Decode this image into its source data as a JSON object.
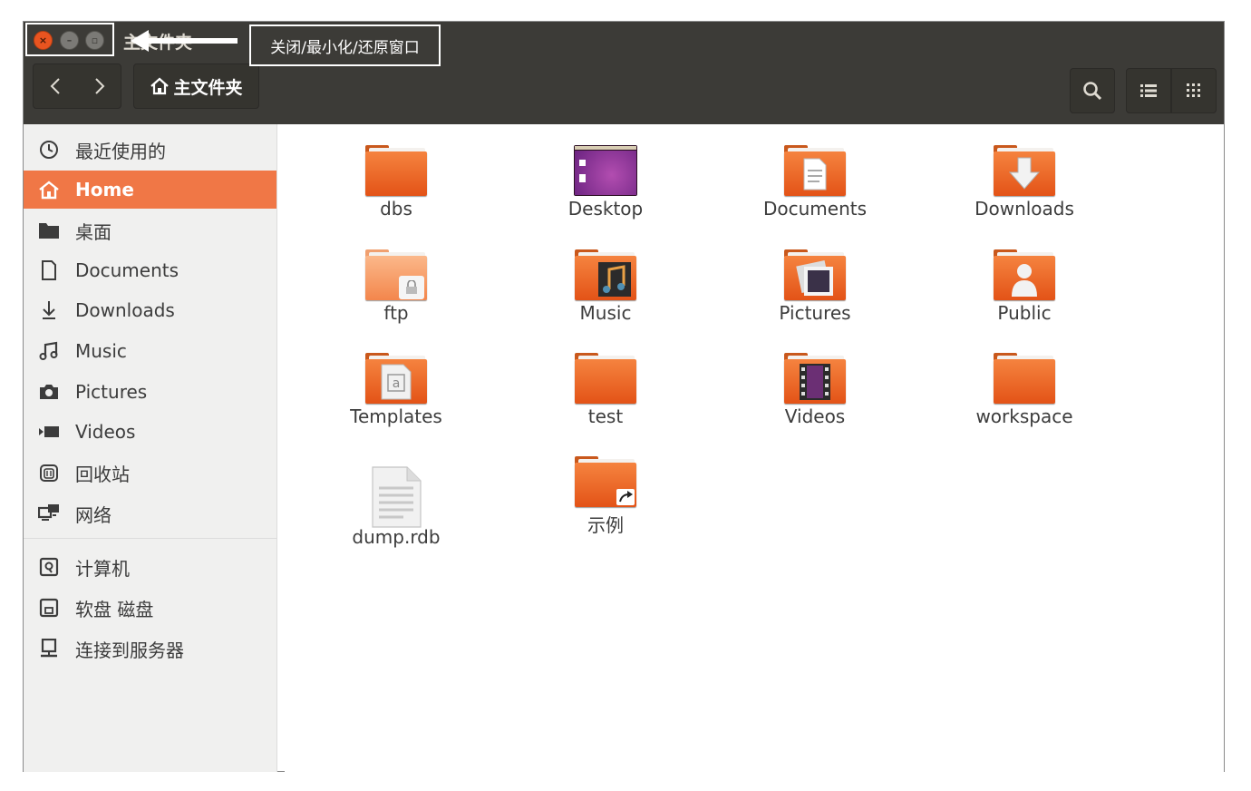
{
  "window": {
    "title": "主文件夹",
    "annotation": "关闭/最小化/还原窗口"
  },
  "toolbar": {
    "back_icon": "chevron-left-icon",
    "forward_icon": "chevron-right-icon",
    "breadcrumb": "主文件夹"
  },
  "sidebar": {
    "items": [
      {
        "label": "最近使用的",
        "icon": "clock-icon"
      },
      {
        "label": "Home",
        "icon": "home-icon"
      },
      {
        "label": "桌面",
        "icon": "folder-icon"
      },
      {
        "label": "Documents",
        "icon": "document-icon"
      },
      {
        "label": "Downloads",
        "icon": "download-icon"
      },
      {
        "label": "Music",
        "icon": "music-icon"
      },
      {
        "label": "Pictures",
        "icon": "camera-icon"
      },
      {
        "label": "Videos",
        "icon": "video-icon"
      },
      {
        "label": "回收站",
        "icon": "trash-icon"
      },
      {
        "label": "网络",
        "icon": "network-icon"
      },
      {
        "label": "计算机",
        "icon": "computer-icon"
      },
      {
        "label": "软盘 磁盘",
        "icon": "floppy-icon"
      },
      {
        "label": "连接到服务器",
        "icon": "server-icon"
      }
    ]
  },
  "files": [
    {
      "name": "dbs",
      "type": "folder"
    },
    {
      "name": "Desktop",
      "type": "desktop"
    },
    {
      "name": "Documents",
      "type": "folder-documents"
    },
    {
      "name": "Downloads",
      "type": "folder-downloads"
    },
    {
      "name": "ftp",
      "type": "folder-locked"
    },
    {
      "name": "Music",
      "type": "folder-music"
    },
    {
      "name": "Pictures",
      "type": "folder-pictures"
    },
    {
      "name": "Public",
      "type": "folder-public"
    },
    {
      "name": "Templates",
      "type": "folder-templates"
    },
    {
      "name": "test",
      "type": "folder"
    },
    {
      "name": "Videos",
      "type": "folder-videos"
    },
    {
      "name": "workspace",
      "type": "folder"
    },
    {
      "name": "dump.rdb",
      "type": "file"
    },
    {
      "name": "示例",
      "type": "folder-link"
    }
  ],
  "colors": {
    "accent": "#f07746",
    "header": "#3c3b37",
    "sidebar": "#f0f0ef"
  }
}
